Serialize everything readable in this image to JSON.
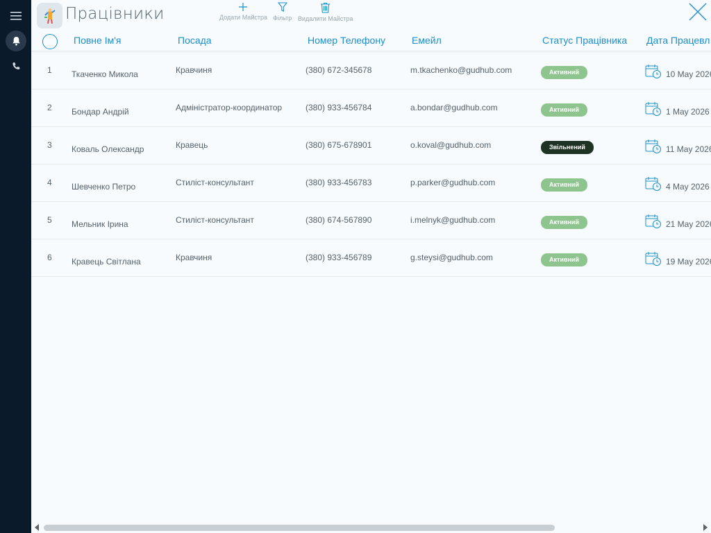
{
  "app": {
    "title": "Працівники"
  },
  "sidebar": {
    "items": [
      {
        "icon": "menu-icon"
      },
      {
        "icon": "bell-icon"
      },
      {
        "icon": "phone-icon"
      }
    ]
  },
  "toolbar": {
    "add_label": "Додати Майстра",
    "filter_label": "Фільтр",
    "delete_label": "Видалити Майстра"
  },
  "table": {
    "columns": [
      "Повне Ім'я",
      "Посада",
      "Номер Телефону",
      "Емейл",
      "Статус Працівника",
      "Дата Працевл"
    ],
    "rows": [
      {
        "num": "1",
        "name": "Ткаченко Микола",
        "position": "Кравчиня",
        "phone": "(380) 672-345678",
        "email": "m.tkachenko@gudhub.com",
        "status": "Активний",
        "date": "10 May 2026"
      },
      {
        "num": "2",
        "name": "Бондар Андрій",
        "position": "Адміністратор-координатор",
        "phone": "(380) 933-456784",
        "email": "a.bondar@gudhub.com",
        "status": "Активний",
        "date": "1 May 2026"
      },
      {
        "num": "3",
        "name": "Коваль Олександр",
        "position": "Кравець",
        "phone": "(380) 675-678901",
        "email": "o.koval@gudhub.com",
        "status": "Звільнений",
        "date": "11 May 2026"
      },
      {
        "num": "4",
        "name": "Шевченко Петро",
        "position": "Стиліст-консультант",
        "phone": "(380) 933-456783",
        "email": "p.parker@gudhub.com",
        "status": "Активний",
        "date": "4 May 2026"
      },
      {
        "num": "5",
        "name": "Мельник Ірина",
        "position": "Стиліст-консультант",
        "phone": "(380) 674-567890",
        "email": "i.melnyk@gudhub.com",
        "status": "Активний",
        "date": "21 May 2026"
      },
      {
        "num": "6",
        "name": "Кравець Світлана",
        "position": "Кравчиня",
        "phone": "(380) 933-456789",
        "email": "g.steysi@gudhub.com",
        "status": "Активний",
        "date": "19 May 2026"
      }
    ]
  },
  "colors": {
    "accent": "#1e8fc8",
    "sidebar": "#0b1a2b",
    "status_active": "#8ec48e",
    "status_fired": "#1f3324"
  }
}
